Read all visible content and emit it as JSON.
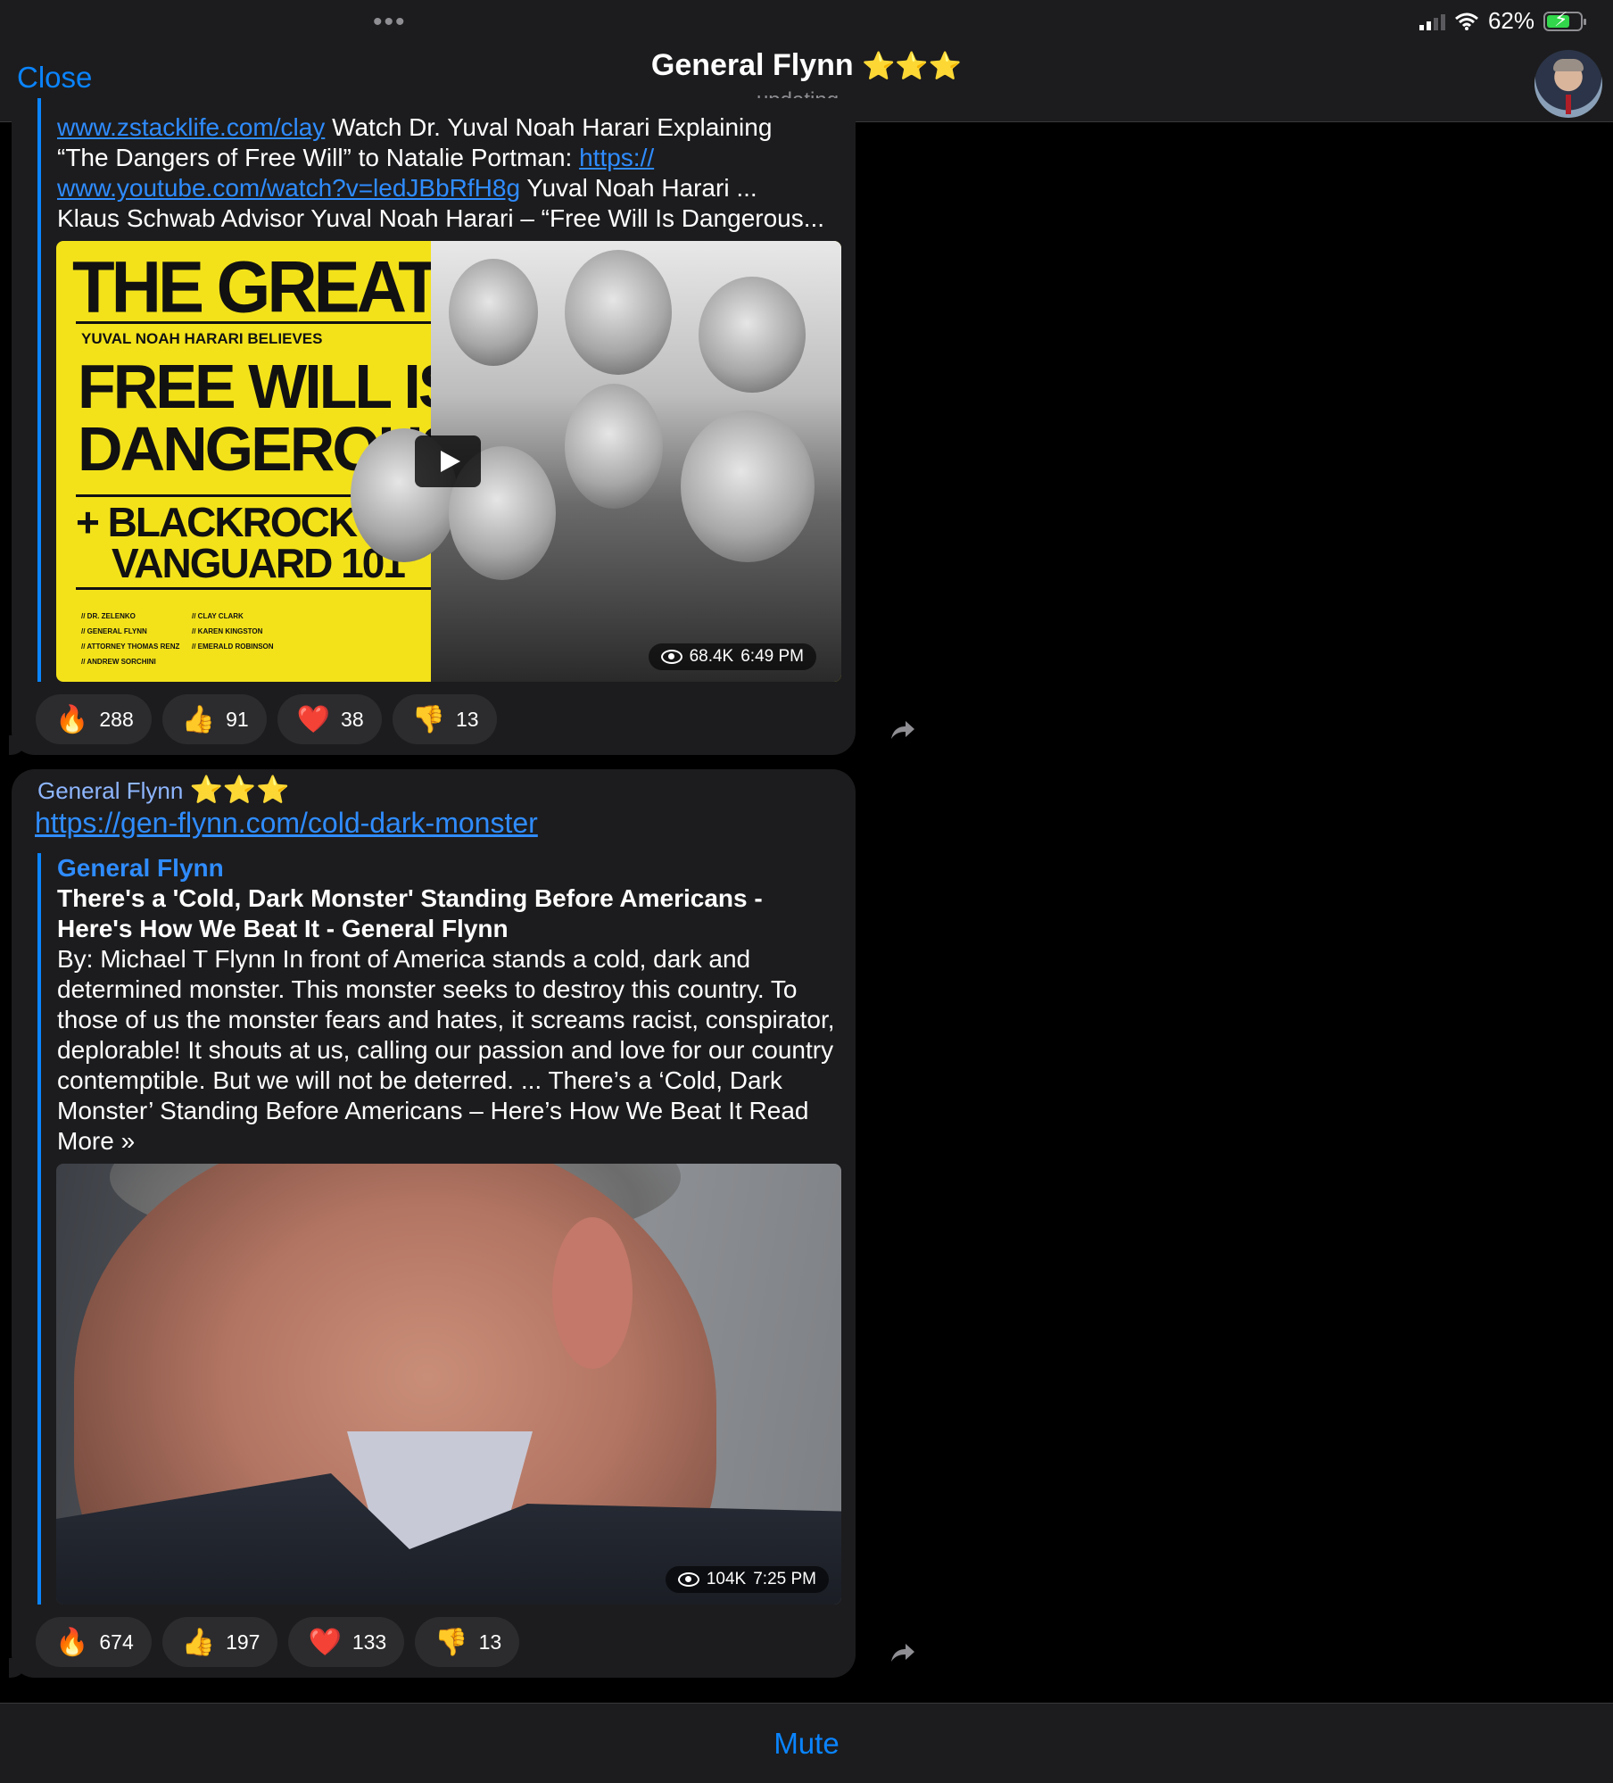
{
  "status_bar": {
    "battery": "62%"
  },
  "header": {
    "close_label": "Close",
    "title": "General Flynn",
    "title_stars": "⭐⭐⭐",
    "subtitle": "updating..."
  },
  "message1": {
    "preview_lines": [
      [
        {
          "text": "www.zstacklife.com/clay",
          "link": true
        },
        {
          "text": " Watch Dr. Yuval Noah Harari Explaining",
          "link": false
        }
      ],
      [
        {
          "text": "“The Dangers of Free Will” to Natalie Portman: ",
          "link": false
        },
        {
          "text": "https://",
          "link": true
        }
      ],
      [
        {
          "text": "www.youtube.com/watch?v=ledJBbRfH8g",
          "link": true
        },
        {
          "text": " Yuval Noah Harari ...",
          "link": false
        }
      ],
      [
        {
          "text": "Klaus Schwab Advisor Yuval Noah Harari – “Free Will Is Dangerous...",
          "link": false
        }
      ]
    ],
    "poster": {
      "title": "THE GREAT RESET",
      "believes": "YUVAL NOAH HARARI BELIEVES",
      "headline_1": "FREE WILL IS",
      "headline_2": "DANGEROUS",
      "sub_1": "+ BLACKROCK &",
      "sub_2": "VANGUARD 101",
      "names_left": [
        "// DR. ZELENKO",
        "// GENERAL FLYNN",
        "// ATTORNEY THOMAS RENZ",
        "// ANDREW SORCHINI"
      ],
      "names_right": [
        "// CLAY CLARK",
        "// KAREN KINGSTON",
        "// EMERALD ROBINSON"
      ]
    },
    "views": "68.4K",
    "time": "6:49 PM",
    "reactions": [
      {
        "emoji": "🔥",
        "count": "288"
      },
      {
        "emoji": "👍",
        "count": "91"
      },
      {
        "emoji": "❤️",
        "count": "38"
      },
      {
        "emoji": "👎",
        "count": "13"
      }
    ]
  },
  "message2": {
    "sender": "General Flynn",
    "sender_stars": "⭐⭐⭐",
    "link": "https://gen-flynn.com/cold-dark-monster",
    "preview_site": "General Flynn",
    "preview_title": "There's a 'Cold, Dark Monster' Standing Before Americans - Here's How We Beat It - General Flynn",
    "preview_body": "By: Michael T Flynn In front of America stands a cold, dark and determined monster. This monster seeks to destroy this country. To those of us the monster fears and hates, it screams racist, conspirator, deplorable! It shouts at us, calling our passion and love for our country contemptible. But we will not be deterred. ... There’s a ‘Cold, Dark Monster’ Standing Before Americans – Here’s How We Beat It Read More »",
    "views": "104K",
    "time": "7:25 PM",
    "reactions": [
      {
        "emoji": "🔥",
        "count": "674"
      },
      {
        "emoji": "👍",
        "count": "197"
      },
      {
        "emoji": "❤️",
        "count": "133"
      },
      {
        "emoji": "👎",
        "count": "13"
      }
    ]
  },
  "bottom_bar": {
    "mute_label": "Mute"
  },
  "colors": {
    "accent": "#0a84ff",
    "bubble": "#1c1c1e",
    "poster_yellow": "#f3e21a"
  }
}
